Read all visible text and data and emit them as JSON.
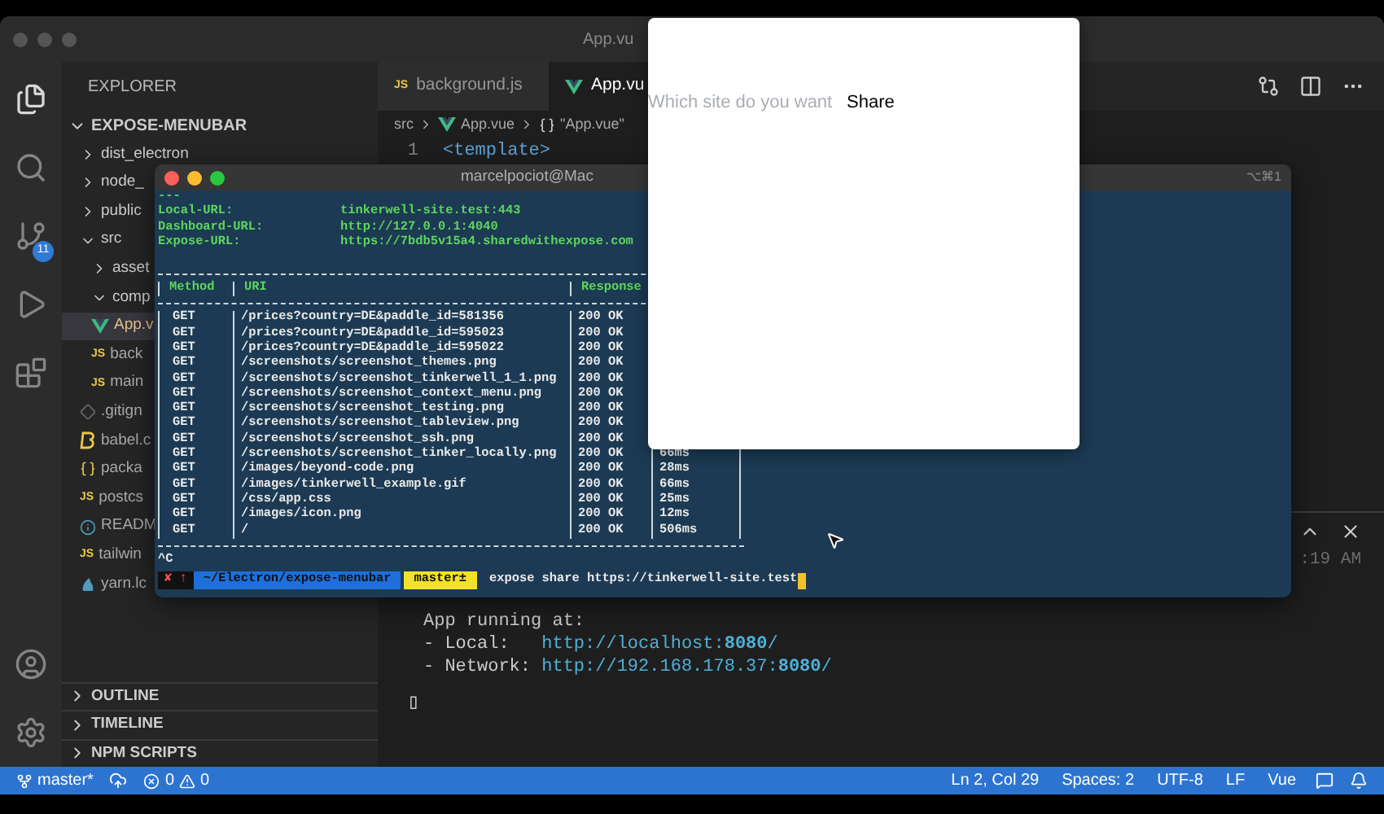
{
  "vscode": {
    "title": "App.vu",
    "activity_bar": {
      "source_control_badge": "11"
    },
    "explorer": {
      "title": "EXPLORER",
      "project": "EXPOSE-MENUBAR",
      "items": [
        {
          "label": "dist_electron",
          "kind": "folder",
          "expanded": false,
          "selected": false
        },
        {
          "label": "node_",
          "kind": "folder",
          "expanded": false,
          "selected": false
        },
        {
          "label": "public",
          "kind": "folder",
          "expanded": false,
          "selected": false
        },
        {
          "label": "src",
          "kind": "folder",
          "expanded": true,
          "selected": false,
          "children": [
            {
              "label": "asset",
              "kind": "folder",
              "expanded": false,
              "selected": false
            },
            {
              "label": "comp",
              "kind": "folder",
              "expanded": true,
              "selected": false
            },
            {
              "label": "App.v",
              "kind": "vue",
              "selected": true
            },
            {
              "label": "back",
              "kind": "js",
              "icon": "JS",
              "selected": false
            },
            {
              "label": "main",
              "kind": "js",
              "icon": "JS",
              "selected": false
            }
          ]
        },
        {
          "label": ".gitign",
          "kind": "git",
          "selected": false
        },
        {
          "label": "babel.c",
          "kind": "babel",
          "selected": false
        },
        {
          "label": "packa",
          "kind": "json",
          "selected": false
        },
        {
          "label": "postcs",
          "kind": "js",
          "icon": "JS",
          "selected": false
        },
        {
          "label": "READM",
          "kind": "info",
          "selected": false
        },
        {
          "label": "tailwin",
          "kind": "js",
          "icon": "JS",
          "selected": false
        },
        {
          "label": "yarn.lc",
          "kind": "yarn",
          "selected": false
        }
      ],
      "sections": [
        {
          "label": "OUTLINE"
        },
        {
          "label": "TIMELINE"
        },
        {
          "label": "NPM SCRIPTS"
        }
      ]
    },
    "tabs": [
      {
        "label": "background.js",
        "kind": "js",
        "icon": "JS",
        "selected": false
      },
      {
        "label": "App.vu",
        "kind": "vue",
        "selected": true
      }
    ],
    "breadcrumb": [
      {
        "label": "src",
        "kind": "folder"
      },
      {
        "label": "App.vue",
        "kind": "vue"
      },
      {
        "label": "\"App.vue\"",
        "kind": "object"
      }
    ],
    "code_lines": [
      {
        "number": "1",
        "text": "<template>"
      }
    ],
    "panel": {
      "time": ":19 AM",
      "output": [
        {
          "label": "App running at:"
        },
        {
          "label": "- Local:   ",
          "link": "http://localhost:**8080**/"
        },
        {
          "label": "- Network: ",
          "link": "http://192.168.178.37:**8080**/"
        }
      ],
      "cursor": "▯"
    },
    "status_bar": {
      "branch": "master*",
      "errors": "0",
      "warnings": "0",
      "items": [
        "Ln 2, Col 29",
        "Spaces: 2",
        "UTF-8",
        "LF",
        "Vue"
      ]
    }
  },
  "terminal": {
    "title": "marcelpociot@Mac",
    "shortcut": "⌥⌘1",
    "separator": "---",
    "info": [
      {
        "key": "Local-URL:",
        "value": "tinkerwell-site.test:443"
      },
      {
        "key": "Dashboard-URL:",
        "value": "http://127.0.0.1:4040"
      },
      {
        "key": "Expose-URL:",
        "value": "https://7bdb5v15a4.sharedwithexpose.com"
      }
    ],
    "columns": [
      "Method",
      "URI",
      "Response"
    ],
    "rows": [
      {
        "method": "GET",
        "uri": "/prices?country=DE&paddle_id=581356",
        "response": "200 OK"
      },
      {
        "method": "GET",
        "uri": "/prices?country=DE&paddle_id=595023",
        "response": "200 OK"
      },
      {
        "method": "GET",
        "uri": "/prices?country=DE&paddle_id=595022",
        "response": "200 OK"
      },
      {
        "method": "GET",
        "uri": "/screenshots/screenshot_themes.png",
        "response": "200 OK"
      },
      {
        "method": "GET",
        "uri": "/screenshots/screenshot_tinkerwell_1_1.png",
        "response": "200 OK"
      },
      {
        "method": "GET",
        "uri": "/screenshots/screenshot_context_menu.png",
        "response": "200 OK"
      },
      {
        "method": "GET",
        "uri": "/screenshots/screenshot_testing.png",
        "response": "200 OK"
      },
      {
        "method": "GET",
        "uri": "/screenshots/screenshot_tableview.png",
        "response": "200 OK"
      },
      {
        "method": "GET",
        "uri": "/screenshots/screenshot_ssh.png",
        "response": "200 OK"
      },
      {
        "method": "GET",
        "uri": "/screenshots/screenshot_tinker_locally.png",
        "response": "200 OK",
        "duration": "66ms"
      },
      {
        "method": "GET",
        "uri": "/images/beyond-code.png",
        "response": "200 OK",
        "duration": "28ms"
      },
      {
        "method": "GET",
        "uri": "/images/tinkerwell_example.gif",
        "response": "200 OK",
        "duration": "66ms"
      },
      {
        "method": "GET",
        "uri": "/css/app.css",
        "response": "200 OK",
        "duration": "25ms"
      },
      {
        "method": "GET",
        "uri": "/images/icon.png",
        "response": "200 OK",
        "duration": "12ms"
      },
      {
        "method": "GET",
        "uri": "/",
        "response": "200 OK",
        "duration": "506ms"
      }
    ],
    "interrupt": "^C",
    "prompt": {
      "status": "✘ ↑",
      "path": "~/Electron/expose-menubar",
      "branch": "master±",
      "command": "expose share https://tinkerwell-site.test"
    }
  },
  "popup": {
    "placeholder": "Which site do you want",
    "button": "Share"
  }
}
